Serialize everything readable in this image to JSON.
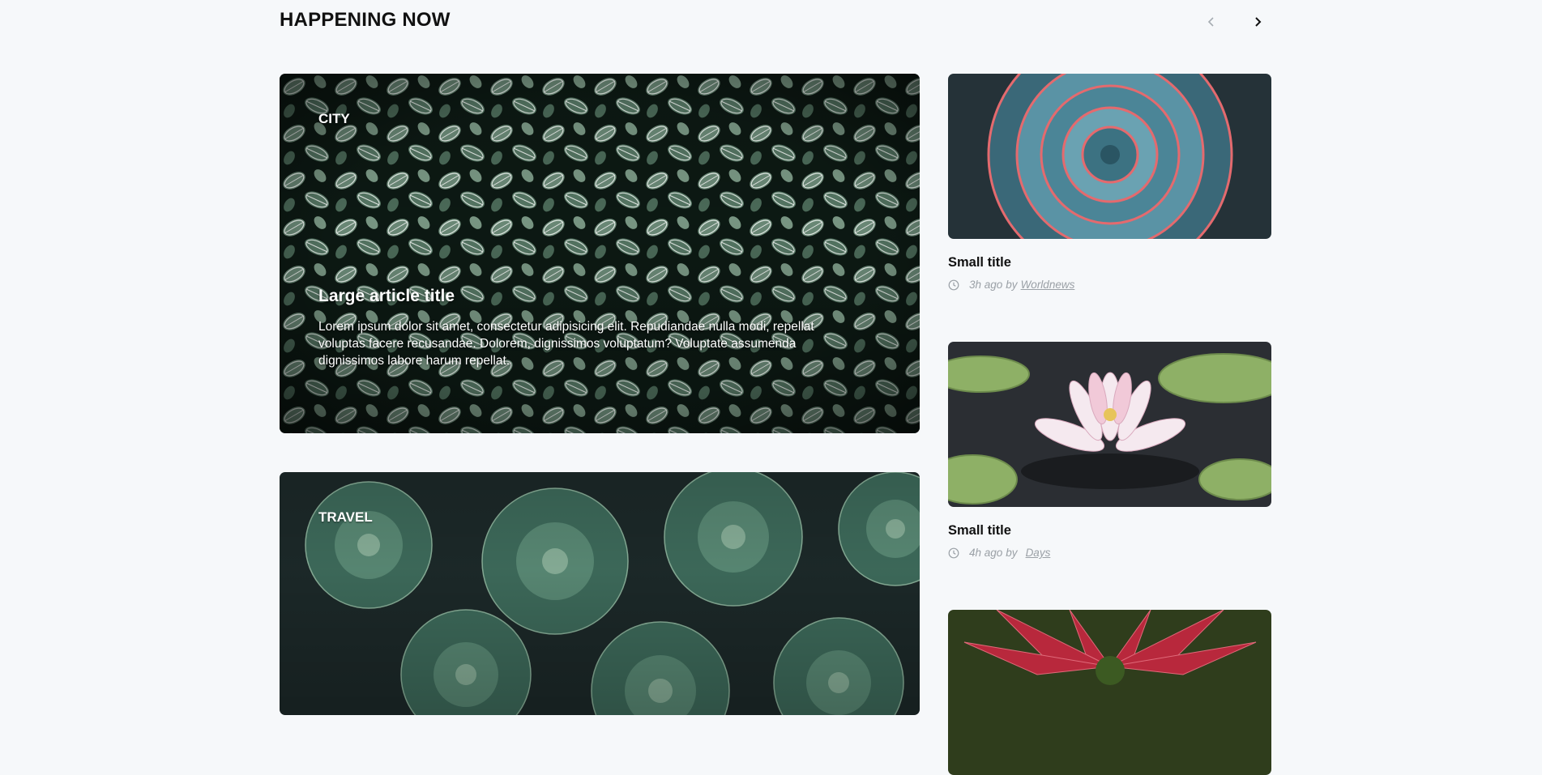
{
  "section": {
    "title": "HAPPENING NOW"
  },
  "nav": {
    "prev_icon": "chevron-left-icon",
    "next_icon": "chevron-right-icon"
  },
  "featured": [
    {
      "category": "CITY",
      "title": "Large article title",
      "excerpt": "Lorem ipsum dolor sit amet, consectetur adipisicing elit. Repudiandae nulla modi, repellat voluptas facere recusandae. Dolorem, dignissimos voluptatum? Voluptate assumenda dignissimos labore harum repellat."
    },
    {
      "category": "TRAVEL"
    }
  ],
  "side": [
    {
      "title": "Small title",
      "time": "3h ago",
      "by": "by",
      "source": "Worldnews"
    },
    {
      "title": "Small title",
      "time": "4h ago",
      "by": "by",
      "source": "Days"
    },
    {}
  ],
  "colors": {
    "background": "#f6f8fa",
    "text": "#111111",
    "meta": "#9aa0a6"
  }
}
